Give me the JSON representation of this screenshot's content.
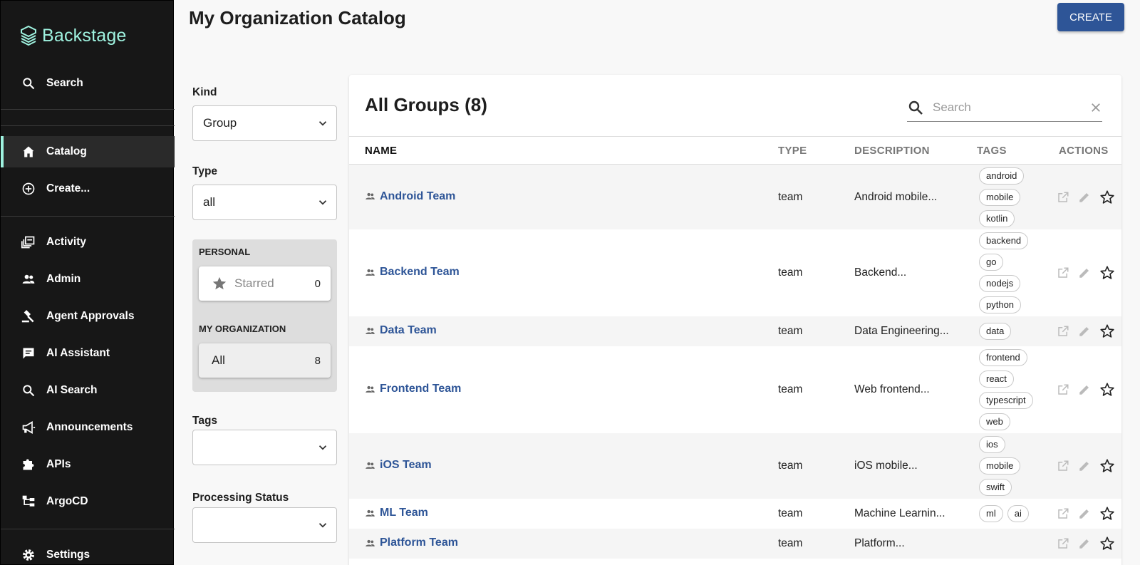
{
  "app": {
    "name": "Backstage"
  },
  "sidebar": {
    "search_label": "Search",
    "items": [
      {
        "label": "Catalog",
        "icon": "home-icon",
        "active": true
      },
      {
        "label": "Create...",
        "icon": "add-circle-icon"
      },
      {
        "label": "Activity",
        "icon": "activity-icon"
      },
      {
        "label": "Admin",
        "icon": "people-icon"
      },
      {
        "label": "Agent Approvals",
        "icon": "gavel-icon"
      },
      {
        "label": "AI Assistant",
        "icon": "chat-icon"
      },
      {
        "label": "AI Search",
        "icon": "search-icon"
      },
      {
        "label": "Announcements",
        "icon": "megaphone-icon"
      },
      {
        "label": "APIs",
        "icon": "puzzle-icon"
      },
      {
        "label": "ArgoCD",
        "icon": "tree-icon"
      }
    ],
    "settings_label": "Settings",
    "accent_color": "#9ff3e0"
  },
  "header": {
    "title": "My Organization Catalog",
    "create_label": "CREATE",
    "create_color": "#2e5597"
  },
  "filters": {
    "kind": {
      "label": "Kind",
      "value": "Group"
    },
    "type": {
      "label": "Type",
      "value": "all"
    },
    "personal": {
      "heading": "PERSONAL",
      "starred_label": "Starred",
      "starred_count": "0"
    },
    "organization": {
      "heading": "MY ORGANIZATION",
      "all_label": "All",
      "all_count": "8"
    },
    "tags": {
      "label": "Tags",
      "value": ""
    },
    "processing_status": {
      "label": "Processing Status",
      "value": ""
    }
  },
  "table": {
    "title": "All Groups (8)",
    "search_placeholder": "Search",
    "columns": {
      "name": "NAME",
      "type": "TYPE",
      "description": "DESCRIPTION",
      "tags": "TAGS",
      "actions": "ACTIONS"
    },
    "rows": [
      {
        "name": "Android Team",
        "type": "team",
        "description": "Android mobile...",
        "tags": [
          "android",
          "mobile",
          "kotlin"
        ]
      },
      {
        "name": "Backend Team",
        "type": "team",
        "description": "Backend...",
        "tags": [
          "backend",
          "go",
          "nodejs",
          "python"
        ]
      },
      {
        "name": "Data Team",
        "type": "team",
        "description": "Data Engineering...",
        "tags": [
          "data"
        ]
      },
      {
        "name": "Frontend Team",
        "type": "team",
        "description": "Web frontend...",
        "tags": [
          "frontend",
          "react",
          "typescript",
          "web"
        ]
      },
      {
        "name": "iOS Team",
        "type": "team",
        "description": "iOS mobile...",
        "tags": [
          "ios",
          "mobile",
          "swift"
        ]
      },
      {
        "name": "ML Team",
        "type": "team",
        "description": "Machine Learnin...",
        "tags": [
          "ml",
          "ai"
        ]
      },
      {
        "name": "Platform Team",
        "type": "team",
        "description": "Platform...",
        "tags": []
      }
    ],
    "link_color": "#2e5597"
  }
}
